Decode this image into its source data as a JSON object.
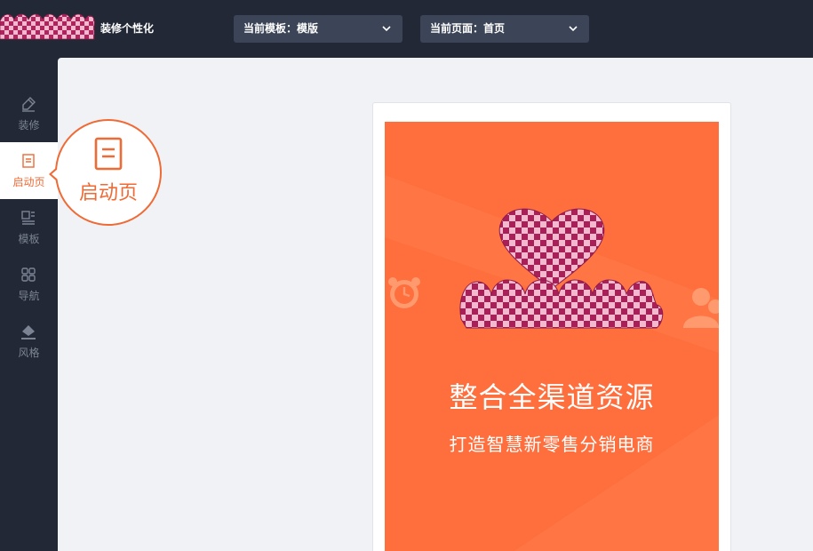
{
  "header": {
    "app_title": "装修个性化",
    "template_dropdown": {
      "label": "当前模板：模版"
    },
    "page_dropdown": {
      "label": "当前页面：首页"
    }
  },
  "sidebar": {
    "items": [
      {
        "label": "装修",
        "icon": "brush-icon"
      },
      {
        "label": "启动页",
        "icon": "document-icon",
        "active": true
      },
      {
        "label": "模板",
        "icon": "layout-template-icon"
      },
      {
        "label": "导航",
        "icon": "grid-icon"
      },
      {
        "label": "风格",
        "icon": "paint-bucket-icon"
      }
    ]
  },
  "callout": {
    "label": "启动页",
    "icon": "document-icon"
  },
  "preview": {
    "headline": "整合全渠道资源",
    "subline": "打造智慧新零售分销电商"
  },
  "colors": {
    "accent": "#f06a35",
    "splash_bg": "#fe6f3d",
    "dark_bg": "#222836",
    "dropdown_bg": "#3c4457"
  }
}
